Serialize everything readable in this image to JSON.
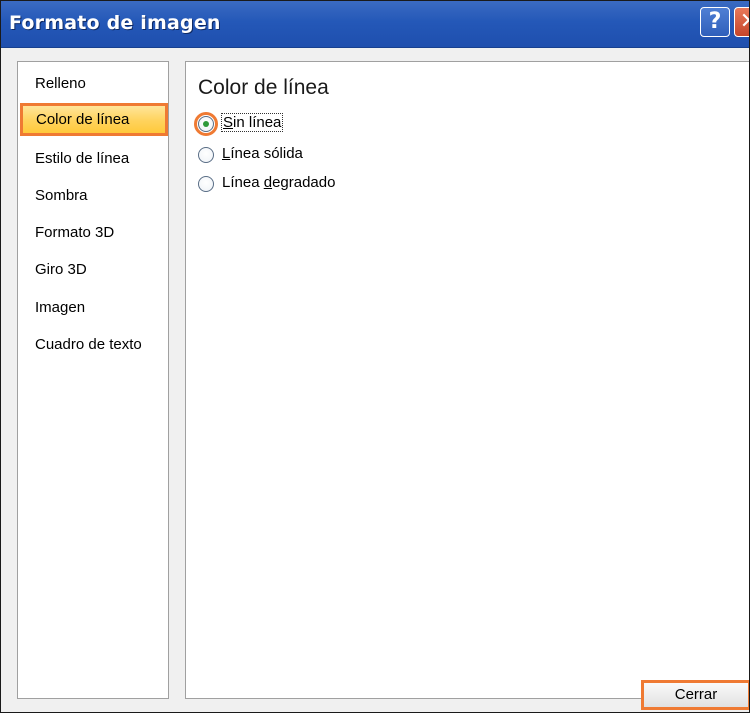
{
  "window": {
    "title": "Formato de imagen"
  },
  "titlebar": {
    "help_glyph": "?",
    "close_glyph": "✕"
  },
  "sidebar": {
    "items": [
      {
        "label": "Relleno",
        "selected": false
      },
      {
        "label": "Color de línea",
        "selected": true
      },
      {
        "label": "Estilo de línea",
        "selected": false
      },
      {
        "label": "Sombra",
        "selected": false
      },
      {
        "label": "Formato 3D",
        "selected": false
      },
      {
        "label": "Giro 3D",
        "selected": false
      },
      {
        "label": "Imagen",
        "selected": false
      },
      {
        "label": "Cuadro de texto",
        "selected": false
      }
    ]
  },
  "panel": {
    "title": "Color de línea",
    "options": [
      {
        "label": "Sin línea",
        "accel": "S",
        "rest": "in línea",
        "checked": true
      },
      {
        "label": "Línea sólida",
        "accel": "L",
        "rest": "ínea sólida",
        "checked": false
      },
      {
        "label": "Línea degradado",
        "pre": "Línea ",
        "accel": "d",
        "rest": "egradado",
        "checked": false
      }
    ]
  },
  "footer": {
    "close_label": "Cerrar"
  },
  "colors": {
    "titlebar": "#2458b8",
    "highlight_border": "#ef7a33",
    "selected_fill": "#ffd35c",
    "radio_dot": "#2f9a3a"
  }
}
